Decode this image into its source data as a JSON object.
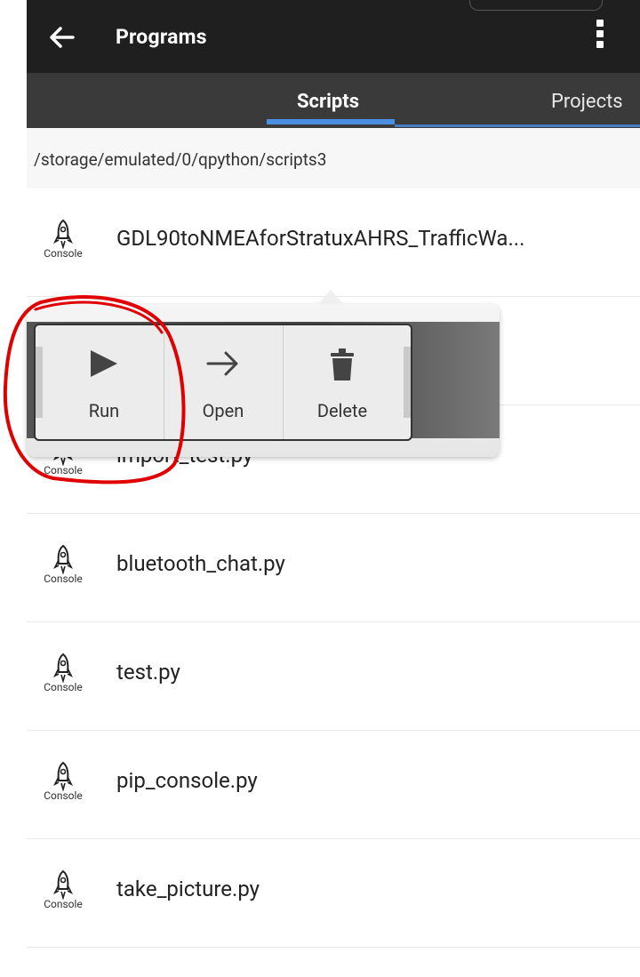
{
  "app_bar": {
    "title": "Programs"
  },
  "tabs": [
    {
      "label": "Scripts"
    },
    {
      "label": "Projects"
    }
  ],
  "path": "/storage/emulated/0/qpython/scripts3",
  "rows": [
    {
      "label": "GDL90toNMEAforStratuxAHRS_TrafficWa...",
      "caption": "Console"
    },
    {
      "label": "",
      "caption": ""
    },
    {
      "label": "import_test.py",
      "caption": "Console"
    },
    {
      "label": "bluetooth_chat.py",
      "caption": "Console"
    },
    {
      "label": "test.py",
      "caption": "Console"
    },
    {
      "label": "pip_console.py",
      "caption": "Console"
    },
    {
      "label": "take_picture.py",
      "caption": "Console"
    }
  ],
  "popup": {
    "run_label": "Run",
    "open_label": "Open",
    "delete_label": "Delete"
  },
  "colors": {
    "app_bar": "#1f1f1f",
    "tab_bar": "#3a3a3a",
    "tab_indicator": "#4a90e2",
    "annotation": "#e00000"
  }
}
